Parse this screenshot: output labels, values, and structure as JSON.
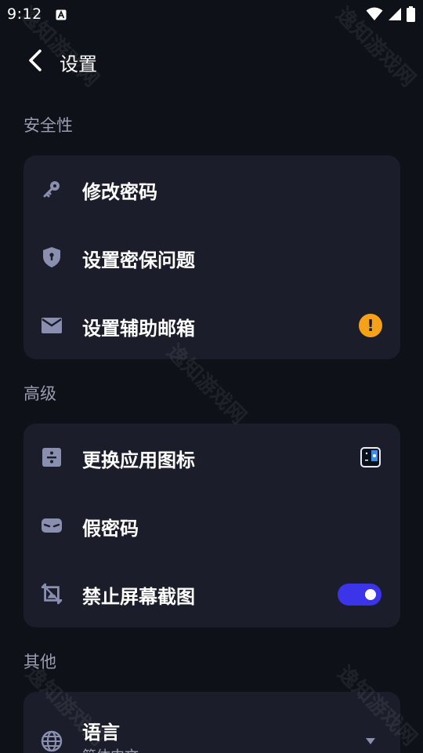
{
  "status_bar": {
    "time": "9:12",
    "icons": [
      "accessibility-a-icon",
      "wifi-icon",
      "signal-icon",
      "battery-icon"
    ]
  },
  "header": {
    "title": "设置"
  },
  "sections": [
    {
      "title": "安全性",
      "items": [
        {
          "label": "修改密码",
          "icon": "key-icon"
        },
        {
          "label": "设置密保问题",
          "icon": "shield-icon"
        },
        {
          "label": "设置辅助邮箱",
          "icon": "mail-icon",
          "trailing": "warning-icon",
          "warning_glyph": "!"
        }
      ]
    },
    {
      "title": "高级",
      "items": [
        {
          "label": "更换应用图标",
          "icon": "app-icon-swap-icon",
          "trailing": "current-app-icon-preview"
        },
        {
          "label": "假密码",
          "icon": "mask-icon"
        },
        {
          "label": "禁止屏幕截图",
          "icon": "screenshot-block-icon",
          "toggle_on": true
        }
      ]
    },
    {
      "title": "其他",
      "items": [
        {
          "label": "语言",
          "sublabel": "简体中文",
          "icon": "globe-icon",
          "trailing": "dropdown-arrow-icon"
        }
      ]
    }
  ],
  "watermark_text": "逸知游戏网",
  "colors": {
    "background": "#0f1119",
    "card": "#1b1e2a",
    "section_title": "#9a9db0",
    "icon": "#8a8fb0",
    "accent": "#3b34e8",
    "warning": "#f5a21a"
  }
}
